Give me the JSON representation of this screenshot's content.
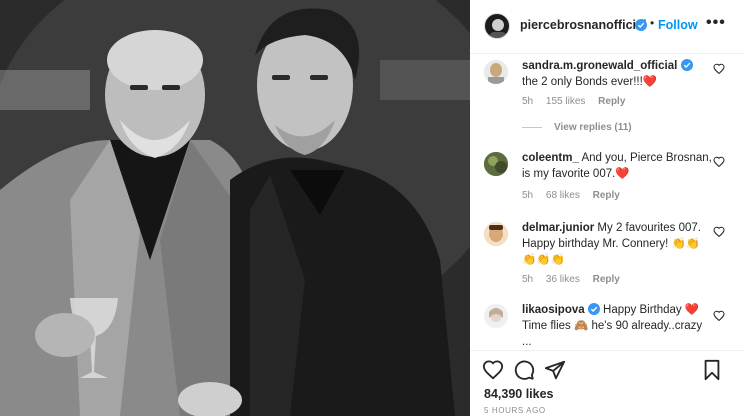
{
  "post": {
    "username": "piercebrosnanofficial",
    "separator": "•",
    "follow_label": "Follow",
    "more_label": "•••"
  },
  "comments": [
    {
      "username": "sandra.m.gronewald_official",
      "verified": true,
      "text": "the 2 only Bonds ever!!!",
      "emoji": "❤️",
      "age": "5h",
      "likes": "155 likes",
      "reply": "Reply",
      "view_replies": "View replies (11)"
    },
    {
      "username": "coleentm_",
      "text": "And you, Pierce Brosnan, is my favorite 007.",
      "emoji": "❤️",
      "age": "5h",
      "likes": "68 likes",
      "reply": "Reply"
    },
    {
      "username": "delmar.junior",
      "text": "My 2 favourites 007. Happy birthday Mr. Connery!",
      "emoji": "👏👏👏👏👏",
      "age": "5h",
      "likes": "36 likes",
      "reply": "Reply"
    },
    {
      "username": "likaosipova",
      "verified": true,
      "text_a": "Happy Birthday",
      "emoji_a": "❤️",
      "text_b": "Time flies",
      "emoji_b": "🙈",
      "text_c": "he's 90 already..crazy ..."
    }
  ],
  "footer": {
    "likes": "84,390 likes",
    "time": "5 HOURS AGO"
  },
  "icons": [
    "heart-icon",
    "comment-icon",
    "share-icon",
    "bookmark-icon",
    "verified-badge-icon",
    "more-icon"
  ],
  "colors": {
    "follow": "#0095f6",
    "verified": "#3897f0",
    "heart": "#ed4956",
    "meta": "#8e8e8e"
  }
}
